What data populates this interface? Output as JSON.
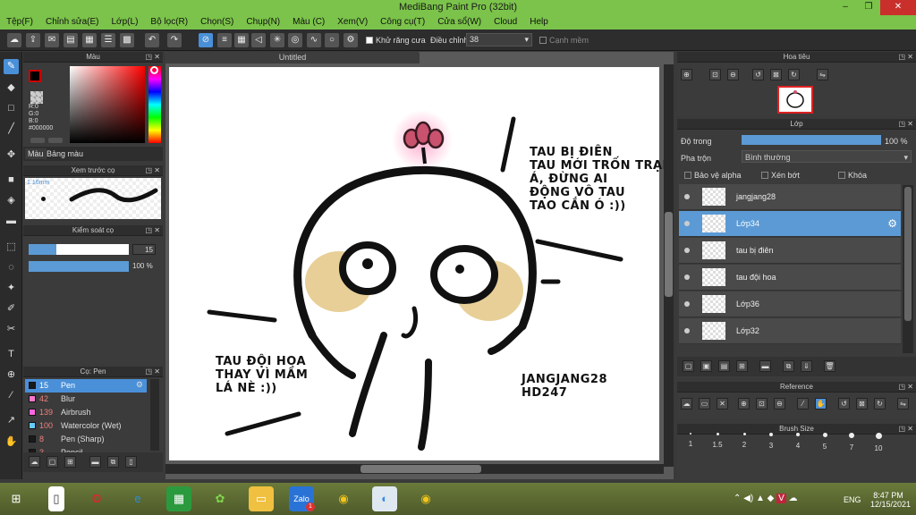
{
  "window": {
    "title": "MediBang Paint Pro (32bit)",
    "min": "–",
    "max": "❐",
    "close": "✕"
  },
  "menu": [
    "Tệp(F)",
    "Chỉnh sửa(E)",
    "Lớp(L)",
    "Bộ lọc(R)",
    "Chọn(S)",
    "Chụp(N)",
    "Màu (C)",
    "Xem(V)",
    "Công cụ(T)",
    "Cửa sổ(W)",
    "Cloud",
    "Help"
  ],
  "toolbar": {
    "antialias_label": "Khử răng cưa",
    "correction_label": "Điều chỉnh",
    "correction_value": "38",
    "soft_edge_label": "Cạnh mềm"
  },
  "color_panel": {
    "title": "Màu",
    "r": "R:0",
    "g": "G:0",
    "b": "B:0",
    "hex": "#000000",
    "tab_color": "Màu",
    "tab_palette": "Bảng màu",
    "accent": "#ff0000"
  },
  "brush_preview": {
    "title": "Xem trước cọ",
    "size": "1.16mm"
  },
  "brush_control": {
    "title": "Kiểm soát cọ",
    "size_value": "15",
    "opacity_value": "100 %",
    "size_fraction": 0.28,
    "opacity_fraction": 1.0
  },
  "brush_list": {
    "title": "Cọ: Pen",
    "items": [
      {
        "size": "15",
        "name": "Pen",
        "color": "#1a1a1a",
        "selected": true
      },
      {
        "size": "42",
        "name": "Blur",
        "color": "#ff77cc",
        "selected": false
      },
      {
        "size": "139",
        "name": "Airbrush",
        "color": "#ff66dd",
        "selected": false
      },
      {
        "size": "100",
        "name": "Watercolor (Wet)",
        "color": "#66ccff",
        "selected": false
      },
      {
        "size": "8",
        "name": "Pen (Sharp)",
        "color": "#1a1a1a",
        "selected": false
      },
      {
        "size": "3",
        "name": "Pencil",
        "color": "#1a1a1a",
        "selected": false
      }
    ]
  },
  "document": {
    "tab": "Untitled"
  },
  "canvas_text": {
    "right_bubble": "TAU BỊ ĐIÊN\nTAU MỚI TRỐN TRẠI\nÁ, ĐỪNG AI\nĐỘNG VÔ TAU\nTAO CẮN Ó :))",
    "left_bubble": "TAU ĐỘI HOA\nTHAY VÌ MẦM\nLÁ NÈ :))",
    "signature": "JANGJANG28\nHD247"
  },
  "navigator": {
    "title": "Hoa tiêu"
  },
  "layer_panel": {
    "title": "Lớp",
    "opacity_label": "Độ trong",
    "opacity_value": "100 %",
    "opacity_fraction": 1.0,
    "blend_label": "Pha trộn",
    "blend_value": "Bình thường",
    "protect_alpha": "Bảo vệ alpha",
    "clipping": "Xén bớt",
    "lock": "Khóa",
    "layers": [
      {
        "name": "jangjang28",
        "selected": false
      },
      {
        "name": "Lớp34",
        "selected": true
      },
      {
        "name": "tau bị điên",
        "selected": false
      },
      {
        "name": "tau đội hoa",
        "selected": false
      },
      {
        "name": "Lớp36",
        "selected": false
      },
      {
        "name": "Lớp32",
        "selected": false
      }
    ]
  },
  "reference": {
    "title": "Reference"
  },
  "brush_size": {
    "title": "Brush Size",
    "sizes": [
      "1",
      "1.5",
      "2",
      "3",
      "4",
      "5",
      "7",
      "10"
    ]
  },
  "taskbar": {
    "lang": "ENG",
    "time": "8:47 PM",
    "date": "12/15/2021",
    "zalo_badge": "1"
  }
}
